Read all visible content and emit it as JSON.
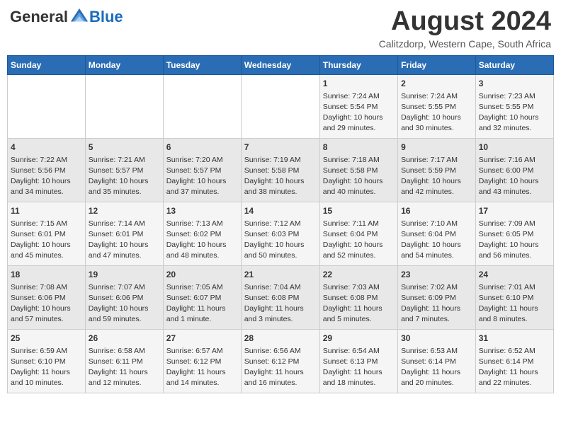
{
  "header": {
    "logo": {
      "general": "General",
      "blue": "Blue"
    },
    "title": "August 2024",
    "location": "Calitzdorp, Western Cape, South Africa"
  },
  "days_of_week": [
    "Sunday",
    "Monday",
    "Tuesday",
    "Wednesday",
    "Thursday",
    "Friday",
    "Saturday"
  ],
  "weeks": [
    [
      {
        "day": "",
        "content": ""
      },
      {
        "day": "",
        "content": ""
      },
      {
        "day": "",
        "content": ""
      },
      {
        "day": "",
        "content": ""
      },
      {
        "day": "1",
        "content": "Sunrise: 7:24 AM\nSunset: 5:54 PM\nDaylight: 10 hours\nand 29 minutes."
      },
      {
        "day": "2",
        "content": "Sunrise: 7:24 AM\nSunset: 5:55 PM\nDaylight: 10 hours\nand 30 minutes."
      },
      {
        "day": "3",
        "content": "Sunrise: 7:23 AM\nSunset: 5:55 PM\nDaylight: 10 hours\nand 32 minutes."
      }
    ],
    [
      {
        "day": "4",
        "content": "Sunrise: 7:22 AM\nSunset: 5:56 PM\nDaylight: 10 hours\nand 34 minutes."
      },
      {
        "day": "5",
        "content": "Sunrise: 7:21 AM\nSunset: 5:57 PM\nDaylight: 10 hours\nand 35 minutes."
      },
      {
        "day": "6",
        "content": "Sunrise: 7:20 AM\nSunset: 5:57 PM\nDaylight: 10 hours\nand 37 minutes."
      },
      {
        "day": "7",
        "content": "Sunrise: 7:19 AM\nSunset: 5:58 PM\nDaylight: 10 hours\nand 38 minutes."
      },
      {
        "day": "8",
        "content": "Sunrise: 7:18 AM\nSunset: 5:58 PM\nDaylight: 10 hours\nand 40 minutes."
      },
      {
        "day": "9",
        "content": "Sunrise: 7:17 AM\nSunset: 5:59 PM\nDaylight: 10 hours\nand 42 minutes."
      },
      {
        "day": "10",
        "content": "Sunrise: 7:16 AM\nSunset: 6:00 PM\nDaylight: 10 hours\nand 43 minutes."
      }
    ],
    [
      {
        "day": "11",
        "content": "Sunrise: 7:15 AM\nSunset: 6:01 PM\nDaylight: 10 hours\nand 45 minutes."
      },
      {
        "day": "12",
        "content": "Sunrise: 7:14 AM\nSunset: 6:01 PM\nDaylight: 10 hours\nand 47 minutes."
      },
      {
        "day": "13",
        "content": "Sunrise: 7:13 AM\nSunset: 6:02 PM\nDaylight: 10 hours\nand 48 minutes."
      },
      {
        "day": "14",
        "content": "Sunrise: 7:12 AM\nSunset: 6:03 PM\nDaylight: 10 hours\nand 50 minutes."
      },
      {
        "day": "15",
        "content": "Sunrise: 7:11 AM\nSunset: 6:04 PM\nDaylight: 10 hours\nand 52 minutes."
      },
      {
        "day": "16",
        "content": "Sunrise: 7:10 AM\nSunset: 6:04 PM\nDaylight: 10 hours\nand 54 minutes."
      },
      {
        "day": "17",
        "content": "Sunrise: 7:09 AM\nSunset: 6:05 PM\nDaylight: 10 hours\nand 56 minutes."
      }
    ],
    [
      {
        "day": "18",
        "content": "Sunrise: 7:08 AM\nSunset: 6:06 PM\nDaylight: 10 hours\nand 57 minutes."
      },
      {
        "day": "19",
        "content": "Sunrise: 7:07 AM\nSunset: 6:06 PM\nDaylight: 10 hours\nand 59 minutes."
      },
      {
        "day": "20",
        "content": "Sunrise: 7:05 AM\nSunset: 6:07 PM\nDaylight: 11 hours\nand 1 minute."
      },
      {
        "day": "21",
        "content": "Sunrise: 7:04 AM\nSunset: 6:08 PM\nDaylight: 11 hours\nand 3 minutes."
      },
      {
        "day": "22",
        "content": "Sunrise: 7:03 AM\nSunset: 6:08 PM\nDaylight: 11 hours\nand 5 minutes."
      },
      {
        "day": "23",
        "content": "Sunrise: 7:02 AM\nSunset: 6:09 PM\nDaylight: 11 hours\nand 7 minutes."
      },
      {
        "day": "24",
        "content": "Sunrise: 7:01 AM\nSunset: 6:10 PM\nDaylight: 11 hours\nand 8 minutes."
      }
    ],
    [
      {
        "day": "25",
        "content": "Sunrise: 6:59 AM\nSunset: 6:10 PM\nDaylight: 11 hours\nand 10 minutes."
      },
      {
        "day": "26",
        "content": "Sunrise: 6:58 AM\nSunset: 6:11 PM\nDaylight: 11 hours\nand 12 minutes."
      },
      {
        "day": "27",
        "content": "Sunrise: 6:57 AM\nSunset: 6:12 PM\nDaylight: 11 hours\nand 14 minutes."
      },
      {
        "day": "28",
        "content": "Sunrise: 6:56 AM\nSunset: 6:12 PM\nDaylight: 11 hours\nand 16 minutes."
      },
      {
        "day": "29",
        "content": "Sunrise: 6:54 AM\nSunset: 6:13 PM\nDaylight: 11 hours\nand 18 minutes."
      },
      {
        "day": "30",
        "content": "Sunrise: 6:53 AM\nSunset: 6:14 PM\nDaylight: 11 hours\nand 20 minutes."
      },
      {
        "day": "31",
        "content": "Sunrise: 6:52 AM\nSunset: 6:14 PM\nDaylight: 11 hours\nand 22 minutes."
      }
    ]
  ]
}
